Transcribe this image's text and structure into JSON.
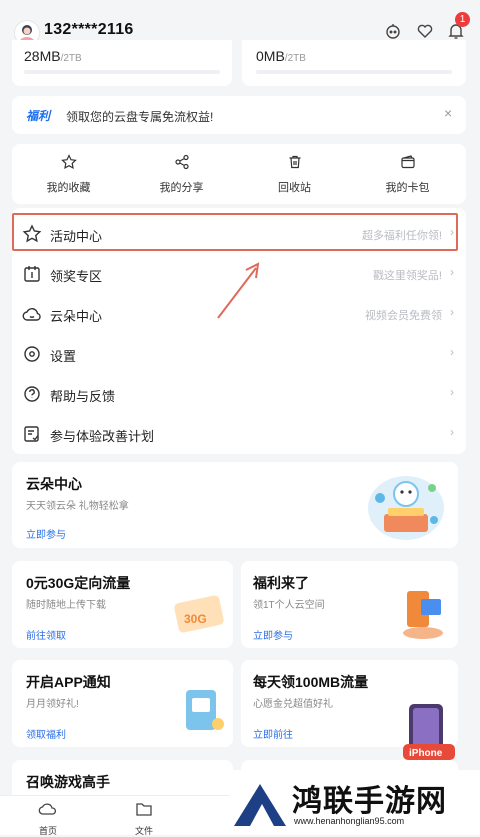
{
  "header": {
    "username": "132****2116",
    "notification_count": "1"
  },
  "storage": [
    {
      "used": "28MB",
      "total": "/2TB"
    },
    {
      "used": "0MB",
      "total": "/2TB"
    }
  ],
  "promo": {
    "tag": "福利",
    "text": "领取您的云盘专属免流权益!",
    "close": "×"
  },
  "quick": [
    {
      "label": "我的收藏",
      "icon": "star-icon"
    },
    {
      "label": "我的分享",
      "icon": "share-icon"
    },
    {
      "label": "回收站",
      "icon": "trash-icon"
    },
    {
      "label": "我的卡包",
      "icon": "wallet-icon"
    }
  ],
  "menu": [
    {
      "label": "活动中心",
      "hint": "超多福利任你领!",
      "icon": "star-icon"
    },
    {
      "label": "领奖专区",
      "hint": "戳这里领奖品!",
      "icon": "calendar-icon"
    },
    {
      "label": "云朵中心",
      "hint": "视频会员免费领",
      "icon": "cloud-icon"
    },
    {
      "label": "设置",
      "hint": "",
      "icon": "settings-icon"
    },
    {
      "label": "帮助与反馈",
      "hint": "",
      "icon": "help-icon"
    },
    {
      "label": "参与体验改善计划",
      "hint": "",
      "icon": "survey-icon"
    }
  ],
  "cloud_card": {
    "title": "云朵中心",
    "sub": "天天领云朵 礼物轻松拿",
    "link": "立即参与"
  },
  "cards": [
    {
      "title": "0元30G定向流量",
      "sub": "随时随地上传下载",
      "link": "前往领取"
    },
    {
      "title": "福利来了",
      "sub": "领1T个人云空间",
      "link": "立即参与"
    },
    {
      "title": "开启APP通知",
      "sub": "月月领好礼!",
      "link": "领取福利"
    },
    {
      "title": "每天领100MB流量",
      "sub": "心愿金兑超值好礼",
      "link": "立即前往"
    },
    {
      "title": "召唤游戏高手",
      "sub": "",
      "link": ""
    }
  ],
  "images": {
    "flow_badge": "30G",
    "phone_label": "iPhone"
  },
  "tabs": [
    {
      "label": "首页"
    },
    {
      "label": "文件"
    }
  ],
  "watermark": {
    "title": "鸿联手游网",
    "url": "www.henanhonglian95.com"
  },
  "colors": {
    "accent": "#2a6fe8",
    "highlight": "#e06a5a",
    "badge": "#ef3b3b"
  }
}
